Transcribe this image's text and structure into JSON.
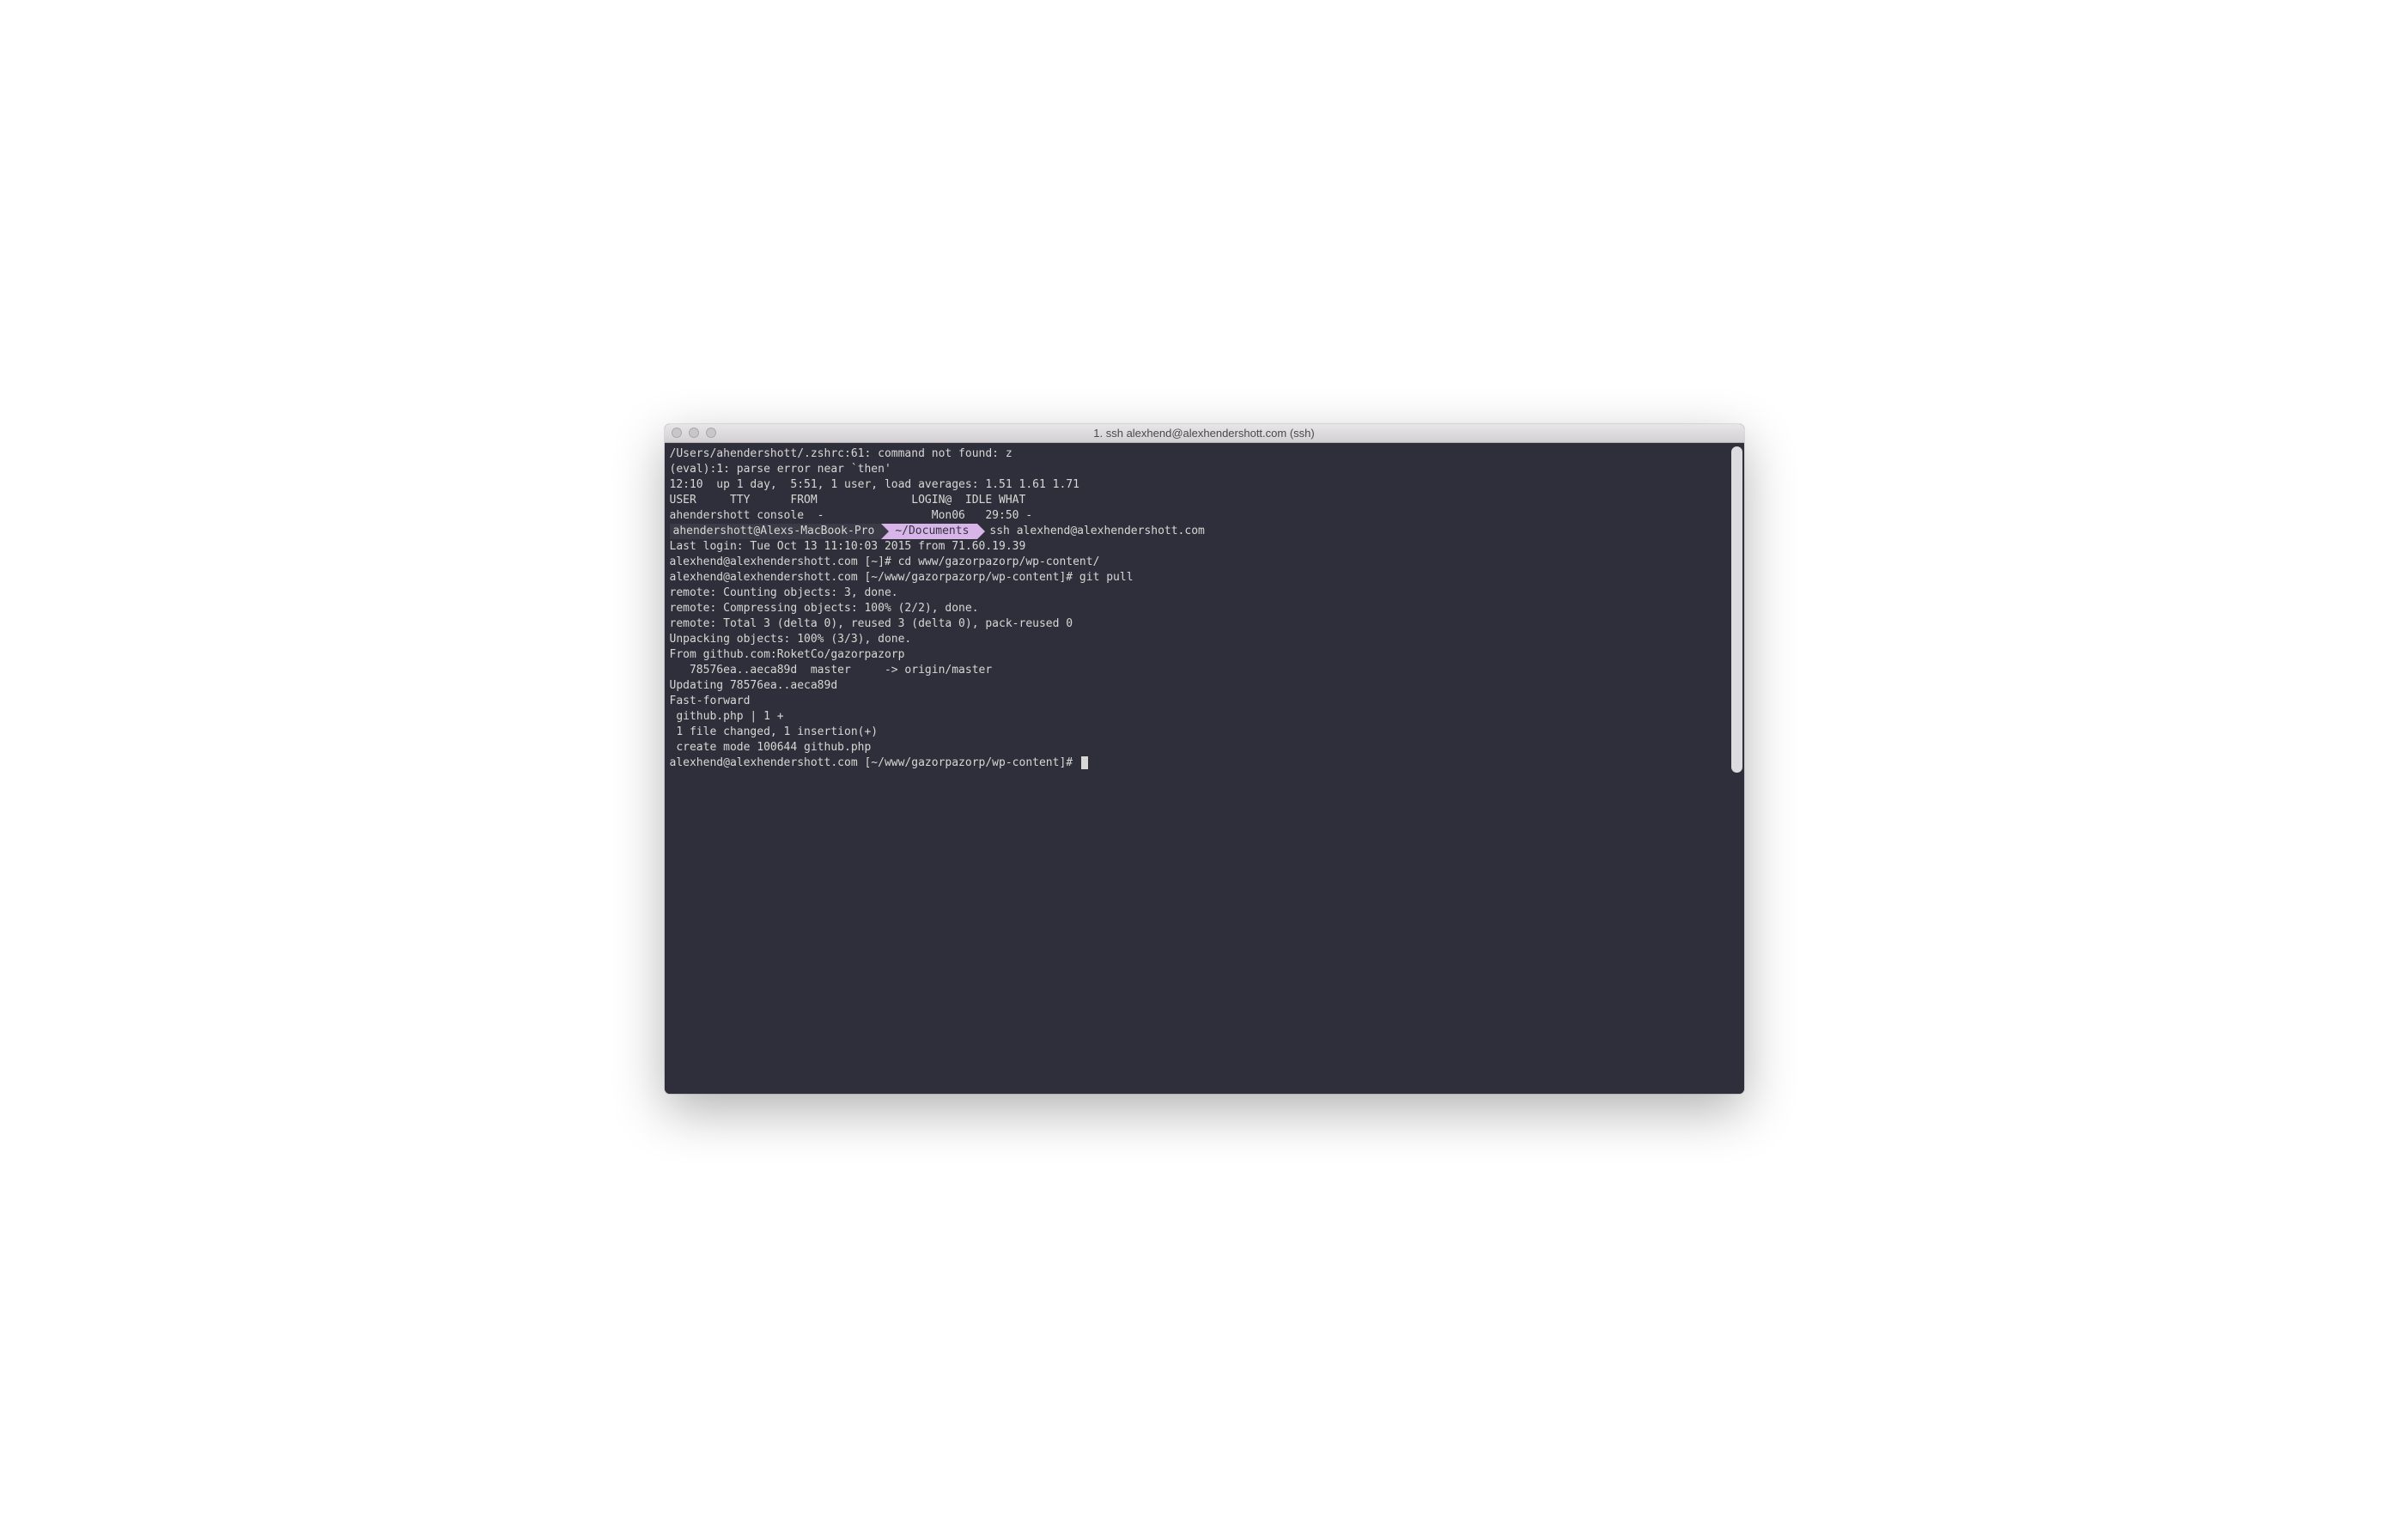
{
  "window": {
    "title": "1. ssh alexhend@alexhendershott.com (ssh)"
  },
  "powerline": {
    "user_host": "ahendershott@Alexs-MacBook-Pro",
    "path": "~/Documents",
    "command": "ssh alexhend@alexhendershott.com"
  },
  "lines": {
    "l01": "/Users/ahendershott/.zshrc:61: command not found: z",
    "l02": "(eval):1: parse error near `then'",
    "l03": "12:10  up 1 day,  5:51, 1 user, load averages: 1.51 1.61 1.71",
    "l04": "USER     TTY      FROM              LOGIN@  IDLE WHAT",
    "l05": "ahendershott console  -                Mon06   29:50 -",
    "l07": "Last login: Tue Oct 13 11:10:03 2015 from 71.60.19.39",
    "l08": "alexhend@alexhendershott.com [~]# cd www/gazorpazorp/wp-content/",
    "l09": "alexhend@alexhendershott.com [~/www/gazorpazorp/wp-content]# git pull",
    "l10": "remote: Counting objects: 3, done.",
    "l11": "remote: Compressing objects: 100% (2/2), done.",
    "l12": "remote: Total 3 (delta 0), reused 3 (delta 0), pack-reused 0",
    "l13": "Unpacking objects: 100% (3/3), done.",
    "l14": "From github.com:RoketCo/gazorpazorp",
    "l15": "   78576ea..aeca89d  master     -> origin/master",
    "l16": "Updating 78576ea..aeca89d",
    "l17": "Fast-forward",
    "l18": " github.php | 1 +",
    "l19": " 1 file changed, 1 insertion(+)",
    "l20": " create mode 100644 github.php",
    "l21": "alexhend@alexhendershott.com [~/www/gazorpazorp/wp-content]# "
  }
}
